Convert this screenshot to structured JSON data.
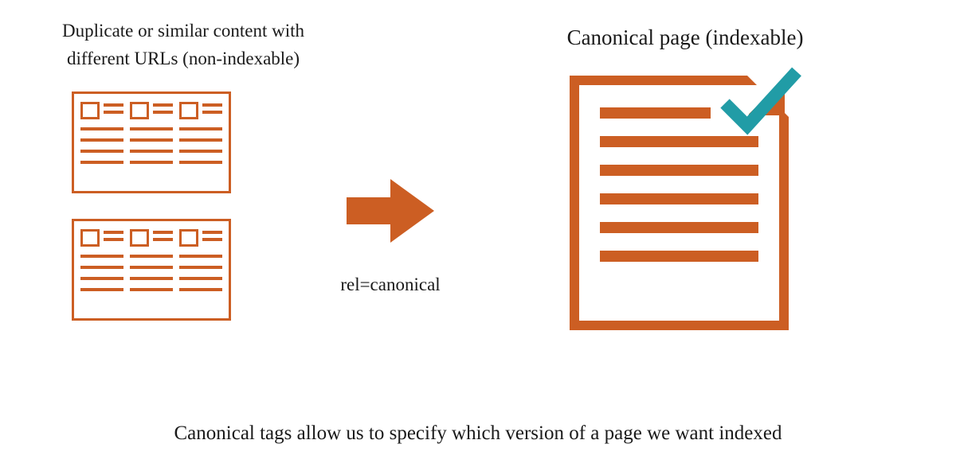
{
  "headings": {
    "left_line1": "Duplicate or similar content with",
    "left_line2": "different URLs (non-indexable)",
    "right": "Canonical page (indexable)"
  },
  "labels": {
    "rel": "rel=canonical"
  },
  "caption": "Canonical tags allow us to specify which version of a page we want indexed",
  "colors": {
    "accent": "#cc5e23",
    "check": "#219ca6"
  }
}
